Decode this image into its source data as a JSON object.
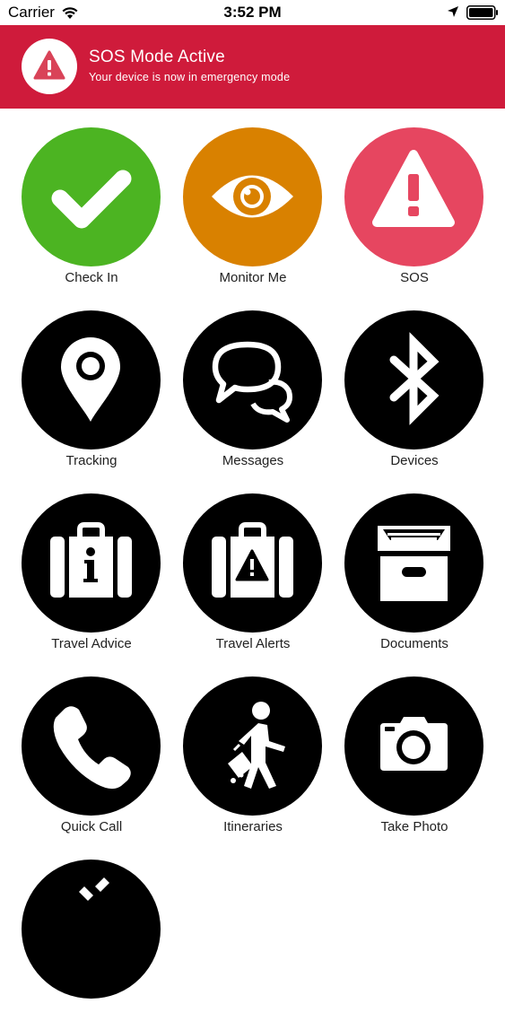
{
  "status_bar": {
    "carrier": "Carrier",
    "time": "3:52 PM",
    "icons": [
      "wifi-icon",
      "location-arrow-icon",
      "battery-icon"
    ]
  },
  "banner": {
    "title": "SOS Mode Active",
    "subtitle": "Your device is now in emergency mode",
    "icon": "warning-triangle-icon",
    "color": "#cf1b3b"
  },
  "tiles": [
    {
      "label": "Check In",
      "icon": "checkmark-icon",
      "color": "#4cb422"
    },
    {
      "label": "Monitor Me",
      "icon": "eye-icon",
      "color": "#d98100"
    },
    {
      "label": "SOS",
      "icon": "warning-triangle-icon",
      "color": "#e64660"
    },
    {
      "label": "Tracking",
      "icon": "location-pin-icon",
      "color": "#000000"
    },
    {
      "label": "Messages",
      "icon": "chat-bubbles-icon",
      "color": "#000000"
    },
    {
      "label": "Devices",
      "icon": "bluetooth-icon",
      "color": "#000000"
    },
    {
      "label": "Travel Advice",
      "icon": "suitcase-info-icon",
      "color": "#000000"
    },
    {
      "label": "Travel Alerts",
      "icon": "suitcase-alert-icon",
      "color": "#000000"
    },
    {
      "label": "Documents",
      "icon": "archive-box-icon",
      "color": "#000000"
    },
    {
      "label": "Quick Call",
      "icon": "phone-icon",
      "color": "#000000"
    },
    {
      "label": "Itineraries",
      "icon": "traveler-icon",
      "color": "#000000"
    },
    {
      "label": "Take Photo",
      "icon": "camera-icon",
      "color": "#000000"
    },
    {
      "label": "",
      "icon": "partial-hidden-icon",
      "color": "#000000"
    }
  ]
}
